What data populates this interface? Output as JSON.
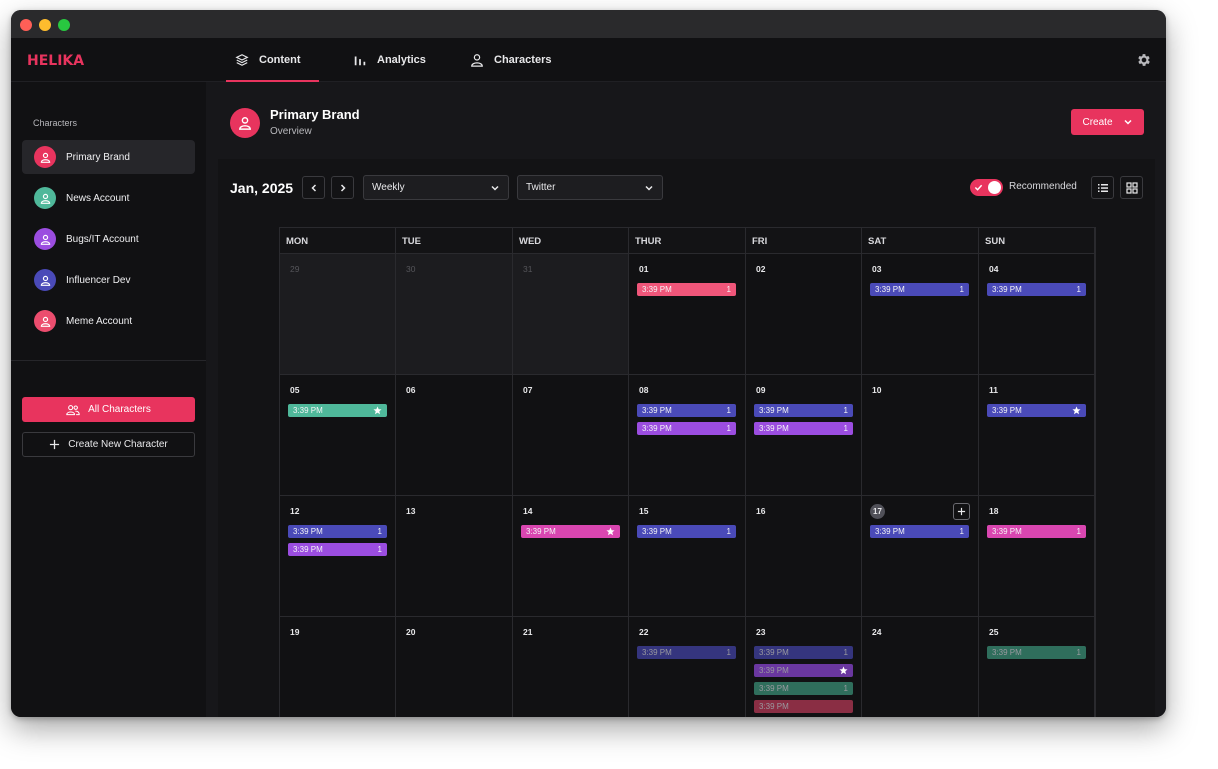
{
  "app": {
    "logo": "HELIKA"
  },
  "nav": {
    "tabs": [
      {
        "label": "Content",
        "icon": "layers-icon",
        "active": true
      },
      {
        "label": "Analytics",
        "icon": "bar-chart-icon",
        "active": false
      },
      {
        "label": "Characters",
        "icon": "user-icon",
        "active": false
      }
    ],
    "settings_icon": "gear-icon"
  },
  "sidebar": {
    "heading": "Characters",
    "items": [
      {
        "label": "Primary Brand",
        "color": "#e8345e",
        "active": true
      },
      {
        "label": "News Account",
        "color": "#4fb89a",
        "active": false
      },
      {
        "label": "Bugs/IT Account",
        "color": "#9b4de0",
        "active": false
      },
      {
        "label": "Influencer Dev",
        "color": "#4a4ab8",
        "active": false
      },
      {
        "label": "Meme Account",
        "color": "#ec4d6e",
        "active": false
      }
    ],
    "all_characters_label": "All Characters",
    "create_new_label": "Create New Character"
  },
  "header": {
    "title": "Primary Brand",
    "subtitle": "Overview",
    "create_label": "Create"
  },
  "toolbar": {
    "month": "Jan, 2025",
    "view_select": "Weekly",
    "platform_select": "Twitter",
    "recommended_label": "Recommended",
    "recommended_on": true
  },
  "colors": {
    "accent": "#e8345e",
    "blue": "#4a4ab8",
    "purple": "#9b4de0",
    "teal": "#4fb89a",
    "pink": "#d946b0",
    "coral": "#ec5a7a"
  },
  "calendar": {
    "weekdays": [
      "MON",
      "TUE",
      "WED",
      "THUR",
      "FRI",
      "SAT",
      "SUN"
    ],
    "weeks": [
      [
        {
          "day": "29",
          "past": true,
          "events": []
        },
        {
          "day": "30",
          "past": true,
          "events": []
        },
        {
          "day": "31",
          "past": true,
          "events": []
        },
        {
          "day": "01",
          "events": [
            {
              "time": "3:39 PM",
              "badge": "1",
              "color": "#f0567a"
            }
          ]
        },
        {
          "day": "02",
          "events": []
        },
        {
          "day": "03",
          "events": [
            {
              "time": "3:39 PM",
              "badge": "1",
              "color": "#4a4ab8"
            }
          ]
        },
        {
          "day": "04",
          "events": [
            {
              "time": "3:39 PM",
              "badge": "1",
              "color": "#4a4ab8"
            }
          ]
        }
      ],
      [
        {
          "day": "05",
          "events": [
            {
              "time": "3:39 PM",
              "star": true,
              "color": "#4fb89a"
            }
          ]
        },
        {
          "day": "06",
          "events": []
        },
        {
          "day": "07",
          "events": []
        },
        {
          "day": "08",
          "events": [
            {
              "time": "3:39 PM",
              "badge": "1",
              "color": "#4a4ab8"
            },
            {
              "time": "3:39 PM",
              "badge": "1",
              "color": "#9b4de0"
            }
          ]
        },
        {
          "day": "09",
          "events": [
            {
              "time": "3:39 PM",
              "badge": "1",
              "color": "#4a4ab8"
            },
            {
              "time": "3:39 PM",
              "badge": "1",
              "color": "#9b4de0"
            }
          ]
        },
        {
          "day": "10",
          "events": []
        },
        {
          "day": "11",
          "events": [
            {
              "time": "3:39 PM",
              "star": true,
              "color": "#4a4ab8"
            }
          ]
        }
      ],
      [
        {
          "day": "12",
          "events": [
            {
              "time": "3:39 PM",
              "badge": "1",
              "color": "#4a4ab8"
            },
            {
              "time": "3:39 PM",
              "badge": "1",
              "color": "#9b4de0"
            }
          ]
        },
        {
          "day": "13",
          "events": []
        },
        {
          "day": "14",
          "events": [
            {
              "time": "3:39 PM",
              "star": true,
              "color": "#d946b0"
            }
          ]
        },
        {
          "day": "15",
          "events": [
            {
              "time": "3:39 PM",
              "badge": "1",
              "color": "#4a4ab8"
            }
          ]
        },
        {
          "day": "16",
          "events": []
        },
        {
          "day": "17",
          "today": true,
          "add_button": true,
          "events": [
            {
              "time": "3:39 PM",
              "badge": "1",
              "color": "#4a4ab8"
            }
          ]
        },
        {
          "day": "18",
          "events": [
            {
              "time": "3:39 PM",
              "badge": "1",
              "color": "#d946b0"
            }
          ]
        }
      ],
      [
        {
          "day": "19",
          "events": []
        },
        {
          "day": "20",
          "events": []
        },
        {
          "day": "21",
          "events": []
        },
        {
          "day": "22",
          "events": [
            {
              "time": "3:39 PM",
              "badge": "1",
              "color": "#35357e",
              "faded": true
            }
          ]
        },
        {
          "day": "23",
          "events": [
            {
              "time": "3:39 PM",
              "badge": "1",
              "color": "#35357e",
              "faded": true
            },
            {
              "time": "3:39 PM",
              "star": true,
              "color": "#6a37a0",
              "faded": true
            },
            {
              "time": "3:39 PM",
              "badge": "1",
              "color": "#2f6e5c",
              "faded": true
            },
            {
              "time": "3:39 PM",
              "color": "#8a2e44",
              "faded": true
            }
          ]
        },
        {
          "day": "24",
          "events": []
        },
        {
          "day": "25",
          "events": [
            {
              "time": "3:39 PM",
              "badge": "1",
              "color": "#2f6e5c",
              "faded": true
            }
          ]
        }
      ]
    ]
  }
}
